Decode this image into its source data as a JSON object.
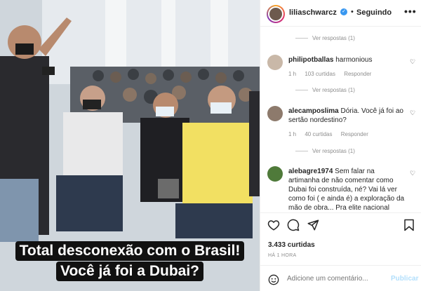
{
  "photo": {
    "caption_line1": "Total desconexão com o Brasil!",
    "caption_line2": "Você já foi a Dubai?"
  },
  "header": {
    "username": "liliaschwarcz",
    "separator": "•",
    "follow_label": "Seguindo",
    "more_label": "•••"
  },
  "comments": {
    "replies_1": "Ver respostas (1)",
    "items": [
      {
        "username": "philipotballas",
        "text": "harmonious",
        "time": "1 h",
        "likes": "103 curtidas",
        "reply": "Responder"
      },
      {
        "username": "alecamposlima",
        "text": "Dória. Você já foi ao sertão nordestino?",
        "time": "1 h",
        "likes": "40 curtidas",
        "reply": "Responder"
      },
      {
        "username": "alebagre1974",
        "text": "Sem falar na artimanha de não comentar como Dubai foi construída, né? Vai lá ver como foi ( e ainda é) a exploração da mão de obra... Pra elite nacional"
      }
    ],
    "replies_2": "Ver respostas (1)",
    "replies_3": "Ver respostas (1)"
  },
  "actions": {
    "likes": "3.433 curtidas",
    "time": "HÁ 1 HORA",
    "comment_placeholder": "Adicione um comentário...",
    "publish_label": "Publicar"
  },
  "colors": {
    "verified": "#3897f0",
    "publish": "#b2dffc",
    "muted": "#8e8e8e"
  }
}
